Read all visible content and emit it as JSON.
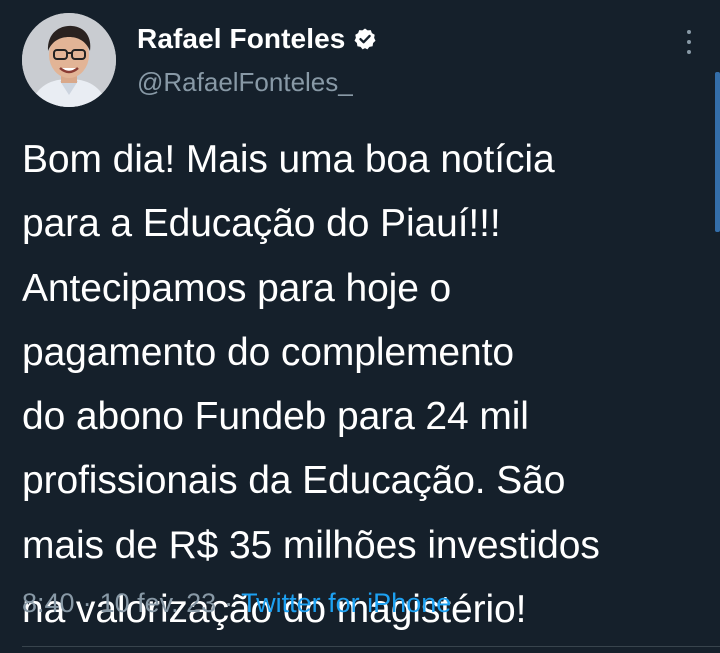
{
  "author": {
    "display_name": "Rafael Fonteles",
    "handle": "@RafaelFonteles_",
    "verified_icon": "verified-badge-icon"
  },
  "tweet": {
    "text": "Bom dia! Mais uma boa notícia\npara a Educação do Piauí!!!\nAntecipamos para hoje o\npagamento do complemento\ndo abono Fundeb para 24 mil\nprofissionais da Educação. São\nmais de R$ 35 milhões investidos\nna valorização do magistério!",
    "time": "8:40",
    "date": "10 fev. 23",
    "separator": "·",
    "source": "Twitter for iPhone"
  },
  "colors": {
    "background": "#15202b",
    "text_primary": "#ffffff",
    "text_secondary": "#8899a6",
    "link": "#1da1f2",
    "divider": "#38444d"
  }
}
